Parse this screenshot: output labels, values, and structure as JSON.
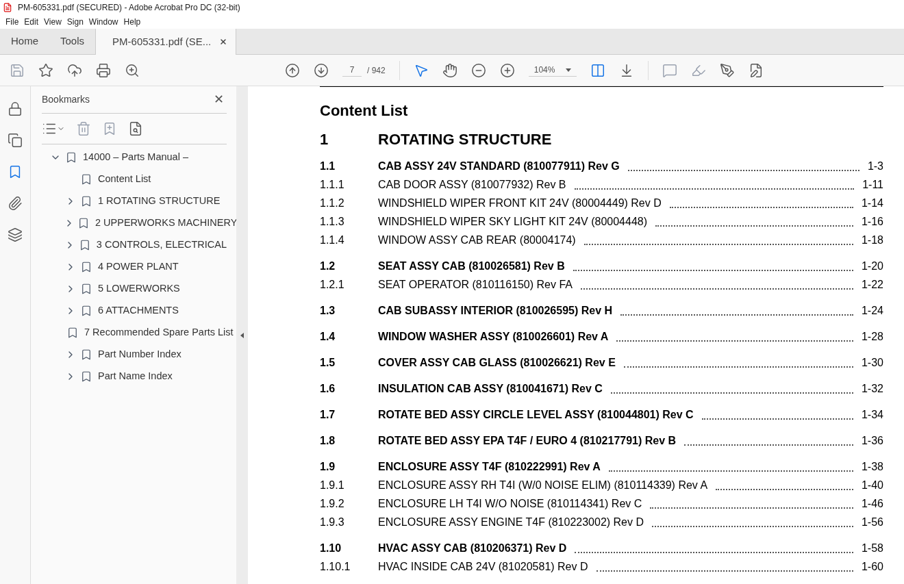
{
  "window": {
    "title": "PM-605331.pdf (SECURED) - Adobe Acrobat Pro DC (32-bit)"
  },
  "menu": [
    "File",
    "Edit",
    "View",
    "Sign",
    "Window",
    "Help"
  ],
  "tabs": [
    {
      "label": "Home",
      "selected": false,
      "closable": false
    },
    {
      "label": "Tools",
      "selected": false,
      "closable": false
    },
    {
      "label": "PM-605331.pdf (SE...",
      "selected": true,
      "closable": true
    }
  ],
  "toolbar": {
    "page": "7",
    "total": "/ 942",
    "zoom": "104%"
  },
  "sidebar": {
    "title": "Bookmarks",
    "close": "✕",
    "items": [
      {
        "label": "14000 – Parts Manual –",
        "expanded": true,
        "children": [
          {
            "label": "Content List"
          },
          {
            "label": "1 ROTATING STRUCTURE",
            "expanded": false
          },
          {
            "label": "2 UPPERWORKS MACHINERY",
            "expanded": false
          },
          {
            "label": "3 CONTROLS, ELECTRICAL",
            "expanded": false
          },
          {
            "label": "4 POWER PLANT",
            "expanded": false
          },
          {
            "label": "5 LOWERWORKS",
            "expanded": false
          },
          {
            "label": "6 ATTACHMENTS",
            "expanded": false
          },
          {
            "label": "7 Recommended Spare Parts List"
          },
          {
            "label": "Part Number Index",
            "expanded": false
          },
          {
            "label": "Part Name Index",
            "expanded": false
          }
        ]
      }
    ]
  },
  "document": {
    "title": "Content List",
    "chapter_number": "1",
    "chapter_title": "ROTATING STRUCTURE",
    "entries": [
      {
        "kind": "major",
        "number": "1.1",
        "title": "CAB ASSY 24V STANDARD (810077911) Rev G",
        "page": "1-3"
      },
      {
        "kind": "minor",
        "number": "1.1.1",
        "title": "CAB DOOR ASSY (810077932) Rev B",
        "page": "1-11"
      },
      {
        "kind": "minor",
        "number": "1.1.2",
        "title": "WINDSHIELD WIPER FRONT KIT 24V (80004449) Rev D",
        "page": "1-14"
      },
      {
        "kind": "minor",
        "number": "1.1.3",
        "title": "WINDSHIELD WIPER SKY LIGHT KIT 24V (80004448)",
        "page": "1-16"
      },
      {
        "kind": "minor",
        "number": "1.1.4",
        "title": "WINDOW ASSY CAB REAR (80004174)",
        "page": "1-18"
      },
      {
        "kind": "major",
        "number": "1.2",
        "title": "SEAT ASSY CAB (810026581) Rev B",
        "page": "1-20"
      },
      {
        "kind": "minor",
        "number": "1.2.1",
        "title": "SEAT OPERATOR (810116150) Rev FA",
        "page": "1-22"
      },
      {
        "kind": "major",
        "number": "1.3",
        "title": "CAB SUBASSY INTERIOR (810026595) Rev H",
        "page": "1-24"
      },
      {
        "kind": "major",
        "number": "1.4",
        "title": "WINDOW WASHER ASSY (810026601) Rev A",
        "page": "1-28"
      },
      {
        "kind": "major",
        "number": "1.5",
        "title": "COVER ASSY CAB GLASS (810026621) Rev E",
        "page": "1-30"
      },
      {
        "kind": "major",
        "number": "1.6",
        "title": "INSULATION CAB ASSY (810041671) Rev C",
        "page": "1-32"
      },
      {
        "kind": "major",
        "number": "1.7",
        "title": "ROTATE BED ASSY CIRCLE LEVEL ASSY (810044801) Rev C",
        "page": "1-34"
      },
      {
        "kind": "major",
        "number": "1.8",
        "title": "ROTATE BED ASSY EPA T4F / EURO 4 (810217791) Rev B",
        "page": "1-36"
      },
      {
        "kind": "major",
        "number": "1.9",
        "title": "ENCLOSURE ASSY T4F (810222991) Rev A",
        "page": "1-38"
      },
      {
        "kind": "minor",
        "number": "1.9.1",
        "title": "ENCLOSURE ASSY RH T4I (W/0 NOISE ELIM) (810114339) Rev A",
        "page": "1-40"
      },
      {
        "kind": "minor",
        "number": "1.9.2",
        "title": "ENCLOSURE LH T4I W/O NOISE (810114341) Rev C",
        "page": "1-46"
      },
      {
        "kind": "minor",
        "number": "1.9.3",
        "title": "ENCLOSURE ASSY ENGINE T4F (810223002) Rev D",
        "page": "1-56"
      },
      {
        "kind": "major",
        "number": "1.10",
        "title": "HVAC ASSY CAB (810206371) Rev D",
        "page": "1-58"
      },
      {
        "kind": "minor",
        "number": "1.10.1",
        "title": "HVAC INSIDE CAB 24V (81020581) Rev D",
        "page": "1-60"
      }
    ]
  }
}
